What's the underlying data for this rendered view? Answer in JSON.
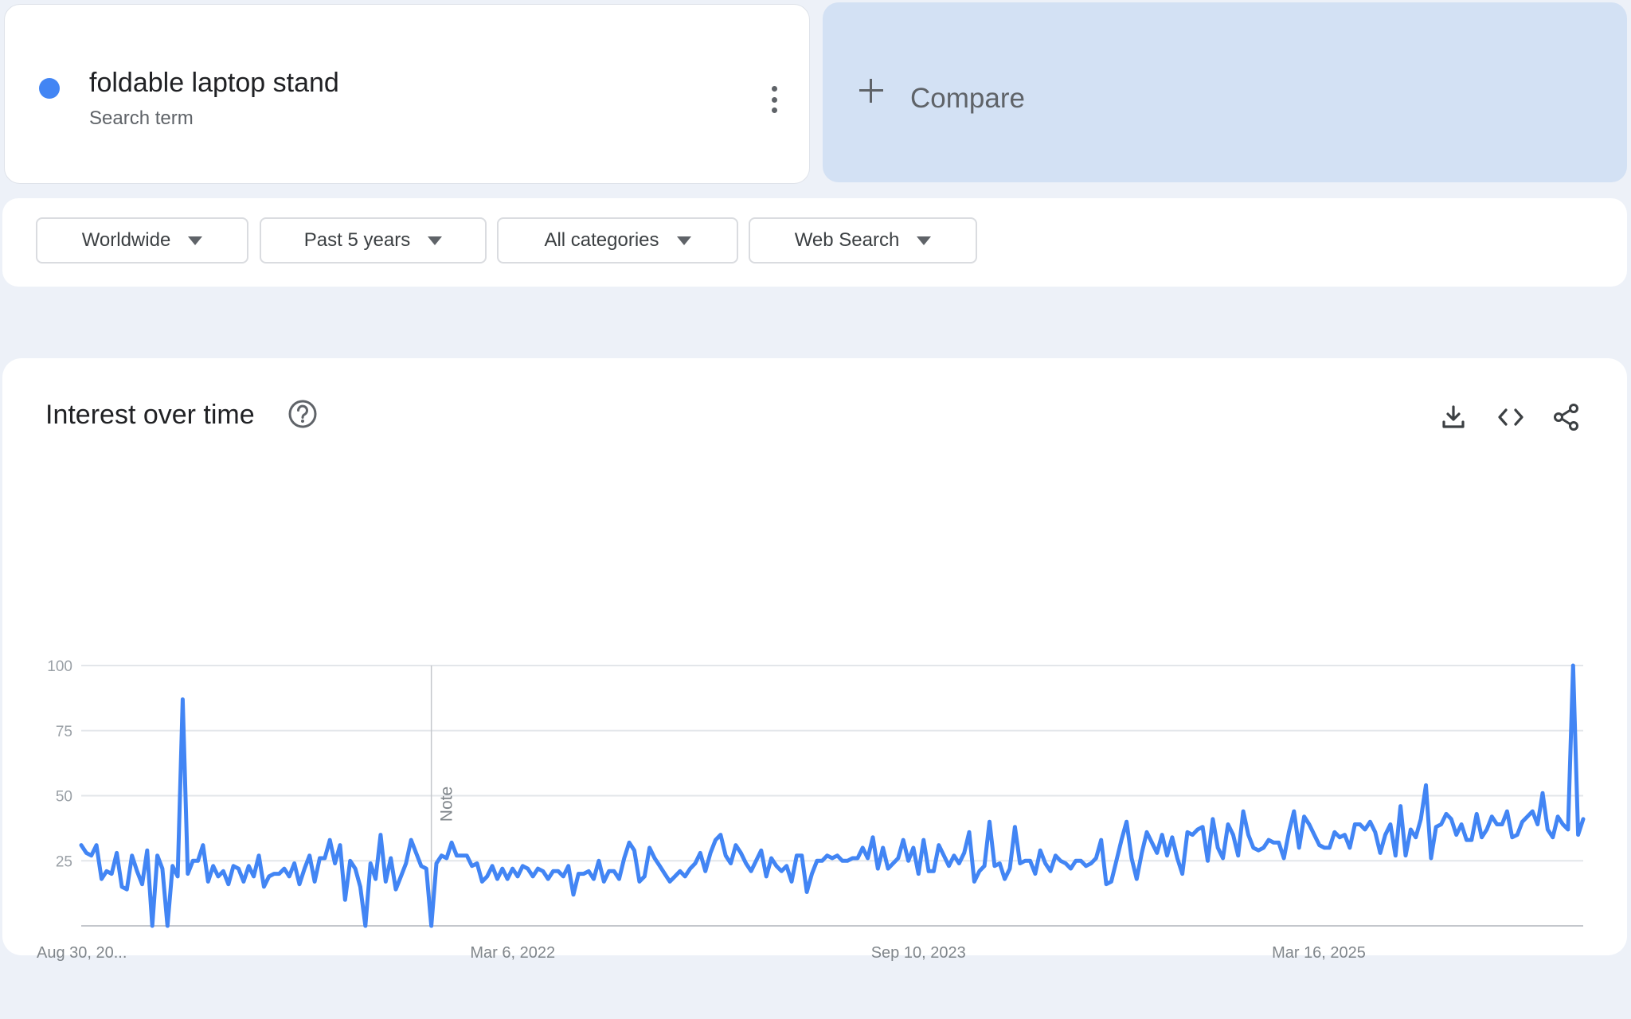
{
  "term": {
    "name": "foldable laptop stand",
    "type": "Search term",
    "dot_color": "#4285f4",
    "menu_icon": "more-vert-icon"
  },
  "compare": {
    "label": "Compare",
    "icon": "plus-icon"
  },
  "filters": [
    {
      "label": "Worldwide"
    },
    {
      "label": "Past 5 years"
    },
    {
      "label": "All categories"
    },
    {
      "label": "Web Search"
    }
  ],
  "section": {
    "title": "Interest over time",
    "help_icon": "help-circle-icon",
    "actions": [
      "download-icon",
      "embed-code-icon",
      "share-icon"
    ]
  },
  "chart_data": {
    "type": "line",
    "title": "",
    "xlabel": "",
    "ylabel": "",
    "ylim": [
      0,
      100
    ],
    "y_ticks": [
      25,
      50,
      75,
      100
    ],
    "x_tick_labels": [
      "Aug 30, 20...",
      "Mar 6, 2022",
      "Sep 10, 2023",
      "Mar 16, 2025"
    ],
    "x_tick_indices": [
      0,
      79,
      158,
      237
    ],
    "note_label": "Note",
    "note_index": 69,
    "grid": true,
    "legend": "none",
    "series": [
      {
        "color": "#4285f4",
        "values": [
          31,
          28,
          27,
          31,
          18,
          21,
          20,
          28,
          15,
          14,
          27,
          21,
          16,
          29,
          0,
          27,
          22,
          0,
          23,
          19,
          87,
          20,
          25,
          25,
          31,
          17,
          23,
          19,
          21,
          16,
          23,
          22,
          17,
          23,
          19,
          27,
          15,
          19,
          20,
          20,
          22,
          19,
          24,
          16,
          22,
          27,
          17,
          26,
          26,
          33,
          24,
          31,
          10,
          25,
          22,
          15,
          0,
          24,
          18,
          35,
          17,
          26,
          14,
          19,
          24,
          33,
          28,
          23,
          22,
          0,
          24,
          27,
          26,
          32,
          27,
          27,
          27,
          23,
          24,
          17,
          19,
          23,
          18,
          22,
          18,
          22,
          19,
          23,
          22,
          19,
          22,
          21,
          18,
          21,
          21,
          19,
          23,
          12,
          20,
          20,
          21,
          18,
          25,
          17,
          21,
          21,
          18,
          26,
          32,
          29,
          17,
          19,
          30,
          26,
          23,
          20,
          17,
          19,
          21,
          19,
          22,
          24,
          28,
          21,
          28,
          33,
          35,
          27,
          24,
          31,
          28,
          24,
          21,
          25,
          29,
          19,
          26,
          23,
          21,
          23,
          17,
          27,
          27,
          13,
          20,
          25,
          25,
          27,
          26,
          27,
          25,
          25,
          26,
          26,
          30,
          26,
          34,
          22,
          30,
          22,
          24,
          26,
          33,
          25,
          30,
          20,
          33,
          21,
          21,
          31,
          27,
          23,
          27,
          24,
          28,
          36,
          17,
          21,
          23,
          40,
          23,
          24,
          18,
          22,
          38,
          24,
          25,
          25,
          20,
          29,
          24,
          21,
          27,
          25,
          24,
          22,
          25,
          25,
          23,
          24,
          26,
          33,
          16,
          17,
          25,
          33,
          40,
          26,
          18,
          28,
          36,
          32,
          28,
          35,
          27,
          34,
          26,
          20,
          36,
          35,
          37,
          38,
          25,
          41,
          30,
          26,
          39,
          35,
          27,
          44,
          35,
          30,
          29,
          30,
          33,
          32,
          32,
          26,
          36,
          44,
          30,
          42,
          39,
          35,
          31,
          30,
          30,
          36,
          34,
          35,
          30,
          39,
          39,
          37,
          40,
          36,
          28,
          35,
          39,
          27,
          46,
          27,
          37,
          34,
          41,
          54,
          26,
          38,
          39,
          43,
          41,
          35,
          39,
          33,
          33,
          43,
          34,
          37,
          42,
          39,
          39,
          44,
          34,
          35,
          40,
          42,
          44,
          39,
          51,
          37,
          34,
          42,
          39,
          37,
          100,
          35,
          41
        ]
      }
    ]
  }
}
